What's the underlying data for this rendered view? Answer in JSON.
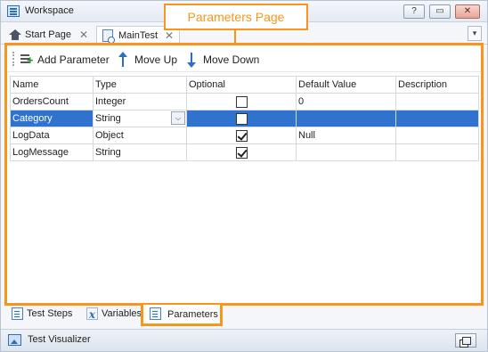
{
  "window": {
    "title": "Workspace",
    "help_glyph": "?",
    "restore_glyph": "▭",
    "close_glyph": "✕"
  },
  "doc_tabs": [
    {
      "label": "Start Page",
      "close_glyph": "✕",
      "icon": "home-icon"
    },
    {
      "label": "MainTest",
      "close_glyph": "✕",
      "icon": "test-icon"
    }
  ],
  "doc_tabs_dropdown": "▾",
  "callout": "Parameters Page",
  "toolbar": {
    "add_parameter": "Add Parameter",
    "move_up": "Move Up",
    "move_down": "Move Down"
  },
  "grid": {
    "columns": [
      "Name",
      "Type",
      "Optional",
      "Default Value",
      "Description"
    ],
    "rows": [
      {
        "name": "OrdersCount",
        "type": "Integer",
        "optional": false,
        "default": "0",
        "description": ""
      },
      {
        "name": "Category",
        "type": "String",
        "optional": false,
        "default": "",
        "description": "",
        "selected": true
      },
      {
        "name": "LogData",
        "type": "Object",
        "optional": true,
        "default": "Null",
        "description": ""
      },
      {
        "name": "LogMessage",
        "type": "String",
        "optional": true,
        "default": "",
        "description": ""
      }
    ],
    "dropdown_glyph": "⌵"
  },
  "bottom_tabs": [
    {
      "label": "Test Steps",
      "icon": "test-steps-icon"
    },
    {
      "label": "Variables",
      "icon": "variables-icon"
    },
    {
      "label": "Parameters",
      "icon": "parameters-icon",
      "active": true
    }
  ],
  "variables_glyph": "x",
  "visualizer": {
    "label": "Test Visualizer"
  },
  "colors": {
    "highlight": "#f7951d",
    "selection": "#2f73cf"
  }
}
